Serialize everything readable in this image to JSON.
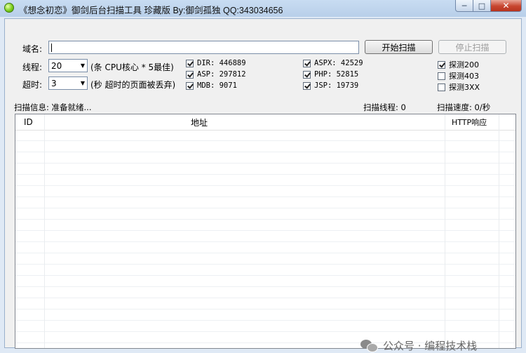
{
  "window": {
    "title": "《想念初恋》御剑后台扫描工具 珍藏版 By:御剑孤独 QQ:343034656",
    "min_glyph": "─",
    "max_glyph": "□",
    "close_glyph": "✕"
  },
  "form": {
    "domain_label": "域名:",
    "domain_value": "",
    "start_button": "开始扫描",
    "stop_button": "停止扫描",
    "threads_label": "线程:",
    "threads_value": "20",
    "threads_hint": "(条 CPU核心 * 5最佳)",
    "timeout_label": "超时:",
    "timeout_value": "3",
    "timeout_hint": "(秒 超时的页面被丢弃)"
  },
  "dictionaries": [
    {
      "label": "DIR: 446889",
      "checked": true
    },
    {
      "label": "ASP: 297812",
      "checked": true
    },
    {
      "label": "MDB: 9071",
      "checked": true
    },
    {
      "label": "ASPX: 42529",
      "checked": true
    },
    {
      "label": "PHP: 52815",
      "checked": true
    },
    {
      "label": "JSP: 19739",
      "checked": true
    }
  ],
  "probes": [
    {
      "label": "探测200",
      "checked": true
    },
    {
      "label": "探测403",
      "checked": false
    },
    {
      "label": "探测3XX",
      "checked": false
    }
  ],
  "status": {
    "info": "扫描信息: 准备就绪...",
    "threads": "扫描线程: 0",
    "speed": "扫描速度: 0/秒"
  },
  "table": {
    "columns": [
      "ID",
      "地址",
      "HTTP响应"
    ],
    "rows": []
  },
  "watermark": {
    "text": "公众号 · 编程技术栈"
  },
  "colors": {
    "title_bar": "#c8dcf2",
    "window_bg": "#f0f0f0",
    "close_button": "#c7452f"
  }
}
